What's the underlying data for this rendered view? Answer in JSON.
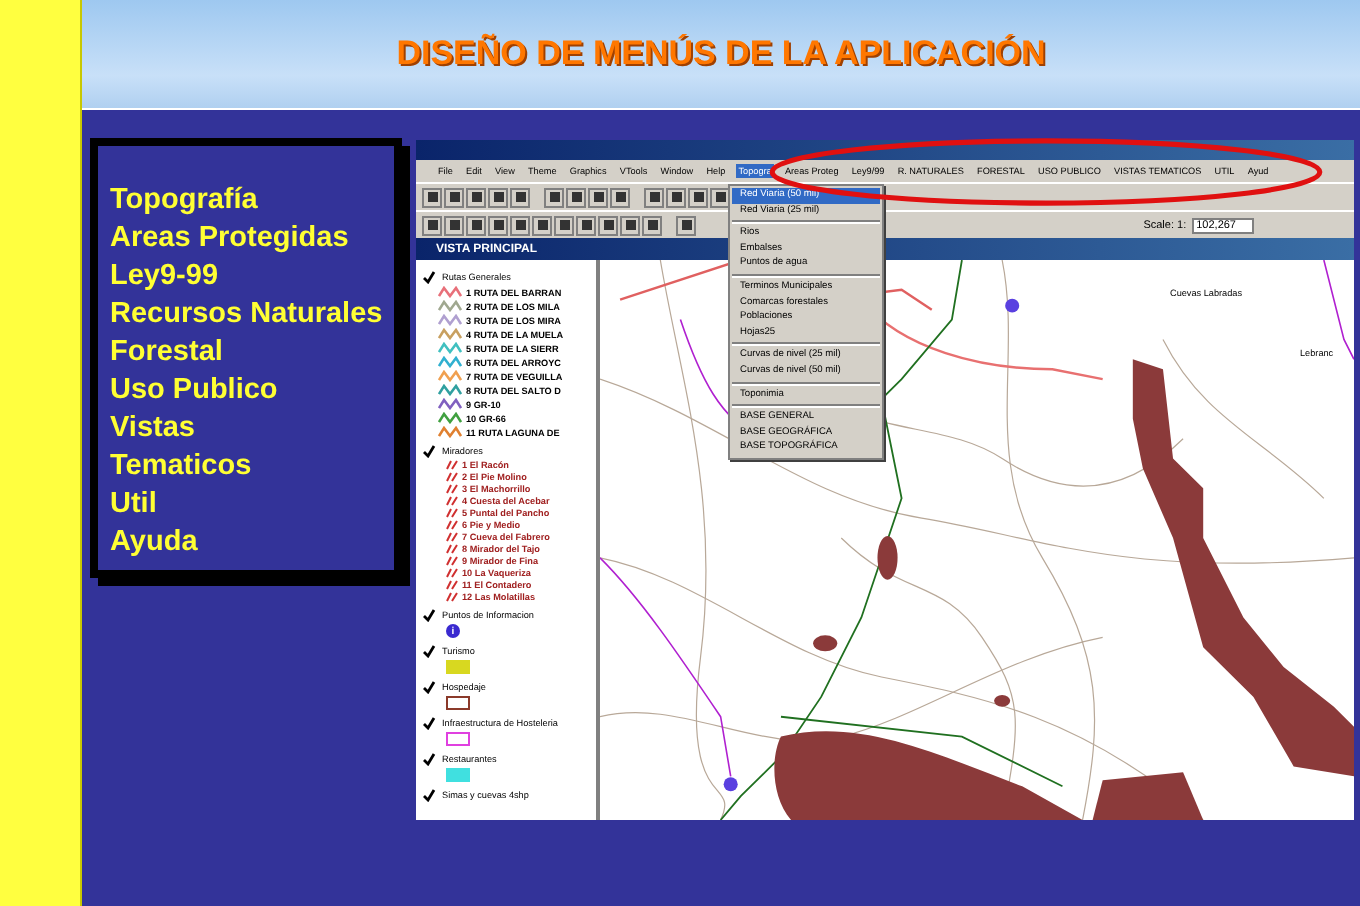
{
  "slide": {
    "title": "DISEÑO DE MENÚS DE LA APLICACIÓN"
  },
  "menu_summary": [
    "Topografía",
    "Areas Protegidas",
    "Ley9-99",
    "Recursos Naturales",
    "Forestal",
    "Uso Publico",
    "Vistas",
    "Tematicos",
    "Util",
    "Ayuda"
  ],
  "app": {
    "menu_bar": [
      {
        "label": "File",
        "selected": false
      },
      {
        "label": "Edit",
        "selected": false
      },
      {
        "label": "View",
        "selected": false
      },
      {
        "label": "Theme",
        "selected": false
      },
      {
        "label": "Graphics",
        "selected": false
      },
      {
        "label": "VTools",
        "selected": false
      },
      {
        "label": "Window",
        "selected": false
      },
      {
        "label": "Help",
        "selected": false
      },
      {
        "label": "Topogra",
        "selected": true
      },
      {
        "label": "Areas Proteg",
        "selected": false
      },
      {
        "label": "Ley9/99",
        "selected": false
      },
      {
        "label": "R. NATURALES",
        "selected": false
      },
      {
        "label": "FORESTAL",
        "selected": false
      },
      {
        "label": "USO PUBLICO",
        "selected": false
      },
      {
        "label": "VISTAS TEMATICOS",
        "selected": false
      },
      {
        "label": "UTIL",
        "selected": false
      },
      {
        "label": "Ayud",
        "selected": false
      }
    ],
    "scale": {
      "label": "Scale: 1:",
      "value": "102,267"
    },
    "view_title": "VISTA PRINCIPAL",
    "dropdown": [
      {
        "kind": "item",
        "label": "Red Viaria (50 mil)",
        "selected": true
      },
      {
        "kind": "item",
        "label": "Red Viaria (25 mil)",
        "selected": false
      },
      {
        "kind": "separator"
      },
      {
        "kind": "item",
        "label": "Rios",
        "selected": false
      },
      {
        "kind": "item",
        "label": "Embalses",
        "selected": false
      },
      {
        "kind": "item",
        "label": "Puntos de agua",
        "selected": false
      },
      {
        "kind": "separator"
      },
      {
        "kind": "item",
        "label": "Terminos Municipales",
        "selected": false
      },
      {
        "kind": "item",
        "label": "Comarcas forestales",
        "selected": false
      },
      {
        "kind": "item",
        "label": "Poblaciones",
        "selected": false
      },
      {
        "kind": "item",
        "label": "Hojas25",
        "selected": false
      },
      {
        "kind": "separator"
      },
      {
        "kind": "item",
        "label": "Curvas de nivel (25 mil)",
        "selected": false
      },
      {
        "kind": "item",
        "label": "Curvas de nivel (50 mil)",
        "selected": false
      },
      {
        "kind": "separator"
      },
      {
        "kind": "item",
        "label": "Toponimia",
        "selected": false
      },
      {
        "kind": "separator"
      },
      {
        "kind": "item",
        "label": "BASE GENERAL",
        "selected": false
      },
      {
        "kind": "item",
        "label": "BASE GEOGRÁFICA",
        "selected": false
      },
      {
        "kind": "item",
        "label": "BASE TOPOGRÁFICA",
        "selected": false
      }
    ],
    "legend": [
      {
        "kind": "routes",
        "title": "Rutas Generales",
        "checked": true,
        "items": [
          {
            "label": "1 RUTA DEL BARRAN",
            "color": "#e8707a"
          },
          {
            "label": "2 RUTA DE LOS MILA",
            "color": "#a0a890"
          },
          {
            "label": "3 RUTA DE LOS MIRA",
            "color": "#b0a0d0"
          },
          {
            "label": "4 RUTA DE LA MUELA",
            "color": "#c8a060"
          },
          {
            "label": "5 RUTA DE LA SIERR",
            "color": "#40c0c0"
          },
          {
            "label": "6 RUTA DEL ARROYC",
            "color": "#30b0d0"
          },
          {
            "label": "7 RUTA DE VEGUILLA",
            "color": "#f0a050"
          },
          {
            "label": "8 RUTA DEL SALTO D",
            "color": "#30a0a0"
          },
          {
            "label": "9 GR-10",
            "color": "#8060c0"
          },
          {
            "label": "10 GR-66",
            "color": "#40a040"
          },
          {
            "label": "11 RUTA LAGUNA DE",
            "color": "#e08030"
          }
        ]
      },
      {
        "kind": "viewpoints",
        "title": "Miradores",
        "checked": true,
        "items": [
          "1 El Racón",
          "2 El Pie Molino",
          "3 El Machorrillo",
          "4 Cuesta del Acebar",
          "5 Puntal del Pancho",
          "6 Pie y Medio",
          "7 Cueva del Fabrero",
          "8 Mirador del Tajo",
          "9 Mirador de Fina",
          "10 La Vaqueriza",
          "11 El Contadero",
          "12 Las Molatillas"
        ]
      },
      {
        "kind": "info",
        "title": "Puntos de Informacion",
        "checked": true,
        "symbol": "i"
      },
      {
        "kind": "swatch",
        "title": "Turismo",
        "checked": true,
        "color": "#d8d820",
        "filled": true
      },
      {
        "kind": "swatch",
        "title": "Hospedaje",
        "checked": true,
        "color": "#8b3a2a",
        "filled": false
      },
      {
        "kind": "swatch",
        "title": "Infraestructura de Hosteleria",
        "checked": true,
        "color": "#e040e0",
        "filled": false
      },
      {
        "kind": "swatch",
        "title": "Restaurantes",
        "checked": true,
        "color": "#40e0e0",
        "filled": true
      },
      {
        "kind": "plain",
        "title": "Simas y cuevas 4shp",
        "checked": true
      }
    ],
    "map_labels": [
      "Cuevas Labradas",
      "Lebranc"
    ]
  }
}
